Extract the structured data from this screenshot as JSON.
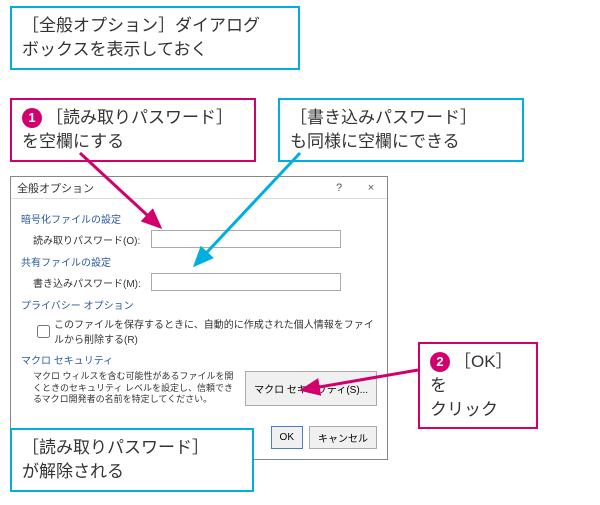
{
  "callouts": {
    "top": {
      "line1": "［全般オプション］ダイアログ",
      "line2": "ボックスを表示しておく"
    },
    "step1": {
      "num": "1",
      "text_a": "［読み取りパスワード］",
      "text_b": "を空欄にする"
    },
    "writepw": {
      "line1": "［書き込みパスワード］",
      "line2": "も同様に空欄にできる"
    },
    "step2": {
      "num": "2",
      "text_a": "［OK］を",
      "text_b": "クリック"
    },
    "result": {
      "line1": "［読み取りパスワード］",
      "line2": "が解除される"
    }
  },
  "dialog": {
    "title": "全般オプション",
    "help": "?",
    "close": "×",
    "section_encrypt": "暗号化ファイルの設定",
    "read_label": "読み取りパスワード(O):",
    "read_value": "",
    "section_share": "共有ファイルの設定",
    "write_label": "書き込みパスワード(M):",
    "write_value": "",
    "section_privacy": "プライバシー オプション",
    "privacy_check": "このファイルを保存するときに、自動的に作成された個人情報をファイルから削除する(R)",
    "section_macro": "マクロ セキュリティ",
    "macro_text": "マクロ ウィルスを含む可能性があるファイルを開くときのセキュリティ レベルを設定し、信頼できるマクロ開発者の名前を特定してください。",
    "macro_btn": "マクロ セキュリティ(S)...",
    "ok": "OK",
    "cancel": "キャンセル"
  }
}
